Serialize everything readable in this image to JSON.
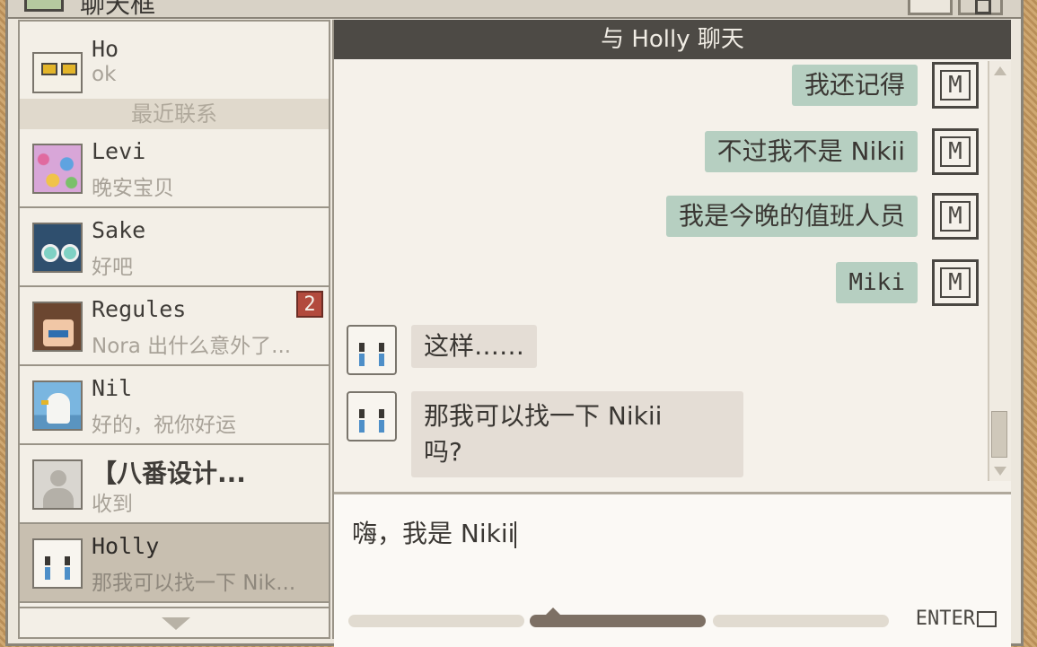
{
  "window": {
    "title": "聊天框"
  },
  "sidebar": {
    "section_header": "最近联系",
    "top_partial": {
      "name": "Ho",
      "preview": "ok"
    },
    "contacts": [
      {
        "name": "Levi",
        "preview": "晚安宝贝"
      },
      {
        "name": "Sake",
        "preview": "好吧"
      },
      {
        "name": "Regules",
        "preview": "Nora 出什么意外了...",
        "badge": "2"
      },
      {
        "name": "Nil",
        "preview": "好的，祝你好运"
      },
      {
        "name": "【八番设计...",
        "preview": "收到"
      },
      {
        "name": "Holly",
        "preview": "那我可以找一下 Nik...",
        "selected": true
      }
    ]
  },
  "chat": {
    "header": "与 Holly 聊天",
    "messages": [
      {
        "from": "me",
        "text": "我还记得"
      },
      {
        "from": "me",
        "text": "不过我不是 Nikii"
      },
      {
        "from": "me",
        "text": "我是今晚的值班人员"
      },
      {
        "from": "me",
        "text": "Miki"
      },
      {
        "from": "holly",
        "text": "这样……"
      },
      {
        "from": "holly",
        "text_line1": "那我可以找一下 Nikii",
        "text_line2": "吗?"
      }
    ],
    "input_value": "嗨，我是 Nikii",
    "enter_label": "ENTER"
  },
  "colors": {
    "outgoing_bubble": "#b6cfc1",
    "incoming_bubble": "#e4ddd5",
    "header_bg": "#4d4a45",
    "badge": "#b24a3d"
  }
}
